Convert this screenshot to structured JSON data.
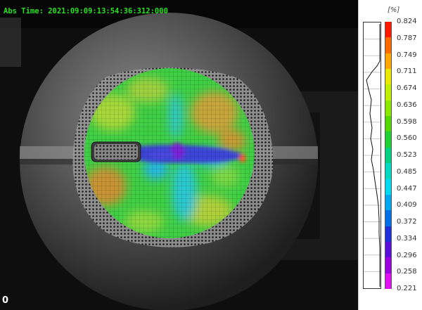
{
  "overlay": {
    "timestamp": "Abs Time: 2021:09:09:13:54:36:312:000",
    "frame_index": "0"
  },
  "legend": {
    "unit": "[%]",
    "ticks": [
      "0.824",
      "0.787",
      "0.749",
      "0.711",
      "0.674",
      "0.636",
      "0.598",
      "0.560",
      "0.523",
      "0.485",
      "0.447",
      "0.409",
      "0.372",
      "0.334",
      "0.296",
      "0.258",
      "0.221"
    ],
    "colors": [
      "#ff1a00",
      "#ff6a00",
      "#ffa500",
      "#e8e800",
      "#bfef00",
      "#8ce800",
      "#52d800",
      "#1fd030",
      "#00d080",
      "#00d8c0",
      "#00d8f0",
      "#00a8f0",
      "#0070e8",
      "#2030d8",
      "#5a10d8",
      "#9a00e0",
      "#e010f0"
    ]
  }
}
